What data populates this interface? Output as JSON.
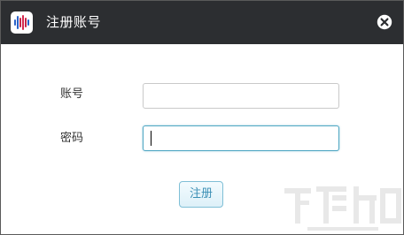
{
  "window": {
    "title": "注册账号",
    "accent_color": "#52a8c4",
    "titlebar_color": "#2c2e31"
  },
  "icons": {
    "app": "app-logo-icon",
    "close": "close-icon"
  },
  "form": {
    "account_label": "账号",
    "account_value": "",
    "password_label": "密码",
    "password_value": "",
    "register_button": "注册"
  }
}
